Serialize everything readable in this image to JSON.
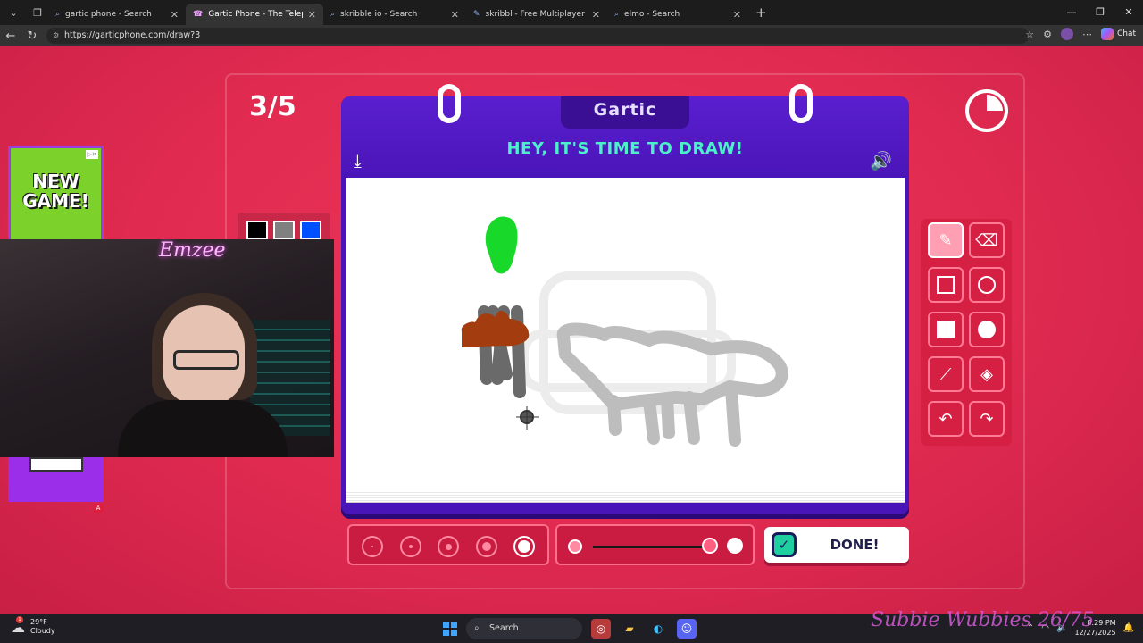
{
  "browser": {
    "tabs": [
      {
        "label": "gartic phone - Search",
        "icon": "search-icon",
        "active": false
      },
      {
        "label": "Gartic Phone - The Telephone Gam",
        "icon": "gartic-icon",
        "active": true
      },
      {
        "label": "skribble io - Search",
        "icon": "search-icon",
        "active": false
      },
      {
        "label": "skribbl - Free Multiplayer Drawing",
        "icon": "skribbl-icon",
        "active": false
      },
      {
        "label": "elmo - Search",
        "icon": "search-icon",
        "active": false
      }
    ],
    "url": "https://garticphone.com/draw?3",
    "chat_label": "Chat"
  },
  "game": {
    "round": "3/5",
    "logo": "Gartic",
    "headline": "HEY, IT'S TIME TO DRAW!",
    "done_label": "DONE!",
    "palette_colors": [
      "#000000",
      "#808080",
      "#0050ff"
    ],
    "selected_tool": "pencil",
    "tools": [
      "pencil",
      "eraser",
      "square-outline",
      "circle-outline",
      "square-filled",
      "circle-filled",
      "line",
      "fill-bucket",
      "undo",
      "redo"
    ],
    "brush_sizes": 5,
    "selected_brush_size": 5,
    "timer_elapsed_fraction": 0.25
  },
  "overlay": {
    "ad_text": "NEW GAME!",
    "cam_sign": "Emzee"
  },
  "taskbar": {
    "weather_temp": "29°F",
    "weather_desc": "Cloudy",
    "weather_badge": "1",
    "search_label": "Search",
    "time": "8:29 PM",
    "date": "12/27/2025"
  },
  "watermark": "Subbie Wubbies 26/75"
}
